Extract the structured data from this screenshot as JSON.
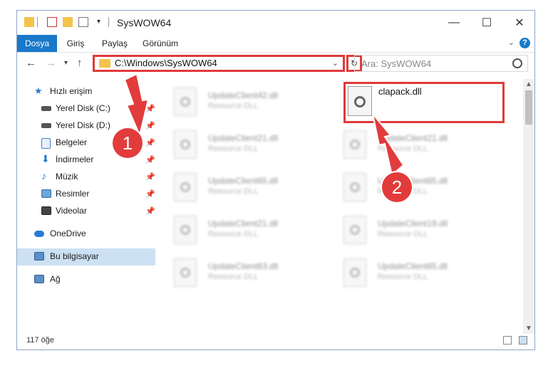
{
  "window": {
    "title": "SysWOW64",
    "controls": {
      "minimize": "—",
      "maximize": "☐",
      "close": "✕"
    }
  },
  "ribbon": {
    "tabs": [
      {
        "label": "Dosya",
        "active": true
      },
      {
        "label": "Giriş",
        "active": false
      },
      {
        "label": "Paylaş",
        "active": false
      },
      {
        "label": "Görünüm",
        "active": false
      }
    ],
    "help": "?"
  },
  "nav": {
    "address": "C:\\Windows\\SysWOW64",
    "search_placeholder": "Ara: SysWOW64"
  },
  "sidebar": {
    "items": [
      {
        "label": "Hızlı erişim",
        "icon": "star-icon",
        "pinned": false
      },
      {
        "label": "Yerel Disk (C:)",
        "icon": "drive-icon",
        "pinned": true
      },
      {
        "label": "Yerel Disk (D:)",
        "icon": "drive-icon",
        "pinned": true
      },
      {
        "label": "Belgeler",
        "icon": "document-icon",
        "pinned": true
      },
      {
        "label": "İndirmeler",
        "icon": "download-icon",
        "pinned": true
      },
      {
        "label": "Müzik",
        "icon": "music-icon",
        "pinned": true
      },
      {
        "label": "Resimler",
        "icon": "pictures-icon",
        "pinned": true
      },
      {
        "label": "Videolar",
        "icon": "video-icon",
        "pinned": true
      },
      {
        "label": "OneDrive",
        "icon": "cloud-icon",
        "pinned": false
      },
      {
        "label": "Bu bilgisayar",
        "icon": "computer-icon",
        "pinned": false
      },
      {
        "label": "Ağ",
        "icon": "network-icon",
        "pinned": false
      }
    ]
  },
  "files": [
    {
      "name": "UpdateClient42.dll",
      "type": "Resource DLL"
    },
    {
      "name": "clapack.dll",
      "type": ""
    },
    {
      "name": "UpdateClient21.dll",
      "type": "Resource DLL"
    },
    {
      "name": "UpdateClient21.dll",
      "type": "Resource DLL"
    },
    {
      "name": "UpdateClient65.dll",
      "type": "Resource DLL"
    },
    {
      "name": "UpdateClient65.dll",
      "type": "Resource DLL"
    },
    {
      "name": "UpdateClient21.dll",
      "type": "Resource DLL"
    },
    {
      "name": "UpdateClient19.dll",
      "type": "Resource DLL"
    },
    {
      "name": "UpdateClient63.dll",
      "type": "Resource DLL"
    },
    {
      "name": "UpdateClient65.dll",
      "type": "Resource DLL"
    }
  ],
  "status": {
    "count": "117 öğe"
  },
  "annotations": {
    "step1": "1",
    "step2": "2"
  },
  "colors": {
    "accent": "#1979ca",
    "highlight": "#e03a3a",
    "folder": "#f3c44a"
  }
}
